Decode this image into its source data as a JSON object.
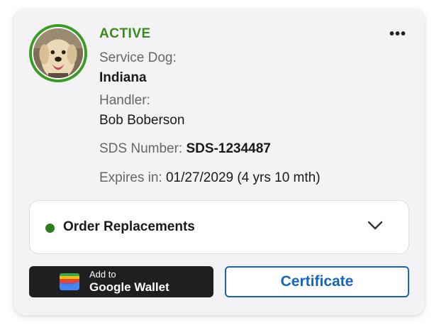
{
  "card": {
    "status": "ACTIVE",
    "avatar_alt": "dog-photo",
    "menu_icon": "more-horizontal-icon",
    "service_dog_label": "Service Dog:",
    "service_dog_name": "Indiana",
    "handler_label": "Handler:",
    "handler_name": "Bob Boberson",
    "sds_label": "SDS Number:",
    "sds_value": "SDS-1234487",
    "expires_label": "Expires in:",
    "expires_value": "01/27/2029 (4 yrs 10 mth)"
  },
  "order": {
    "label": "Order Replacements",
    "status_color": "#2e7d1f",
    "icon": "chevron-down-icon"
  },
  "wallet_button": {
    "small_label": "Add to",
    "big_label": "Google Wallet",
    "icon": "google-wallet-icon"
  },
  "certificate_button": {
    "label": "Certificate"
  },
  "colors": {
    "active_green": "#3a8a1f",
    "ring_green": "#3a9c25",
    "brand_blue": "#1565c0",
    "card_bg": "#f3f3f6",
    "wallet_bg": "#1f1f1f"
  }
}
